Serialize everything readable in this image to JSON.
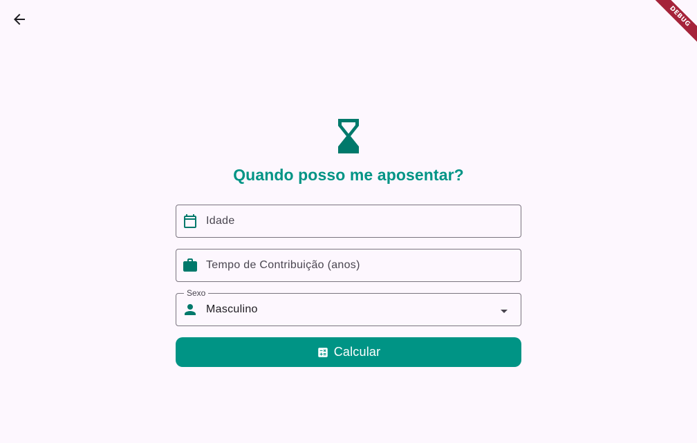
{
  "app": {
    "debug_banner": "DEBUG",
    "accent_color": "#009485",
    "background_color": "#fdf7fe"
  },
  "nav": {
    "back_icon": "arrow-back-icon"
  },
  "header": {
    "icon": "hourglass-icon",
    "title": "Quando posso me aposentar?"
  },
  "form": {
    "age": {
      "icon": "calendar-icon",
      "placeholder": "Idade",
      "value": ""
    },
    "contribution": {
      "icon": "briefcase-icon",
      "placeholder": "Tempo de Contribuição (anos)",
      "value": ""
    },
    "sex": {
      "icon": "person-icon",
      "label": "Sexo",
      "selected": "Masculino",
      "dropdown_icon": "arrow-drop-down-icon"
    },
    "submit": {
      "icon": "calculate-icon",
      "label": "Calcular"
    }
  }
}
